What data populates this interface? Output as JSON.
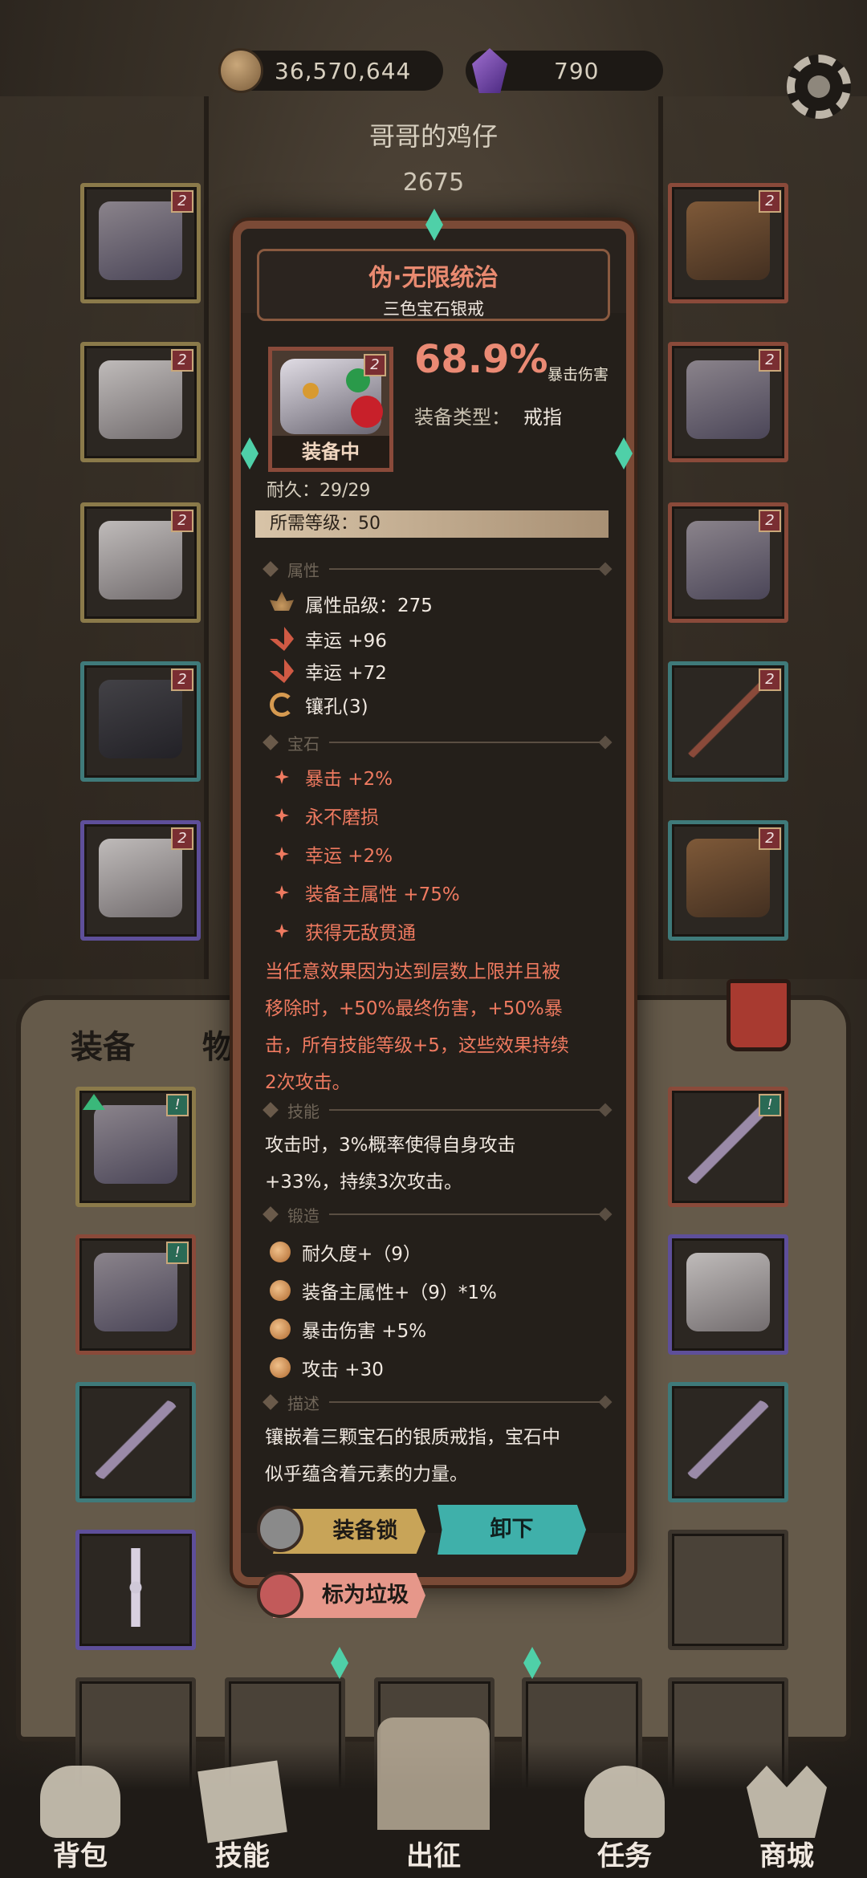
{
  "currency": {
    "gold": "36,570,644",
    "gems": "790"
  },
  "player": {
    "name": "哥哥的鸡仔",
    "power": "2675"
  },
  "tabs": {
    "equip": "装备",
    "items": "物品"
  },
  "item": {
    "name": "伪·无限统治",
    "subtitle": "三色宝石银戒",
    "level_badge": "2",
    "equipped_label": "装备中",
    "main_value": "68.9%",
    "main_stat": "暴击伤害",
    "type_label": "装备类型：",
    "type_value": "戒指",
    "durability": "耐久：29/29",
    "required_level": "所需等级：50",
    "sections": {
      "attributes": "属性",
      "gems": "宝石",
      "skills": "技能",
      "forge": "锻造",
      "description": "描述"
    },
    "attributes": [
      "属性品级：275",
      "幸运 +96",
      "幸运 +72",
      "镶孔(3)"
    ],
    "gem_effects": [
      "暴击 +2%",
      "永不磨损",
      "幸运 +2%",
      "装备主属性 +75%",
      "获得无敌贯通"
    ],
    "gem_description": [
      "当任意效果因为达到层数上限并且被",
      "移除时，+50%最终伤害，+50%暴",
      "击，所有技能等级+5，这些效果持续",
      "2次攻击。"
    ],
    "skill_text": [
      "攻击时，3%概率使得自身攻击",
      "+33%，持续3次攻击。"
    ],
    "forge": [
      "耐久度+（9）",
      "装备主属性+（9）*1%",
      "暴击伤害 +5%",
      "攻击 +30"
    ],
    "description": [
      "镶嵌着三颗宝石的银质戒指，宝石中",
      "似乎蕴含着元素的力量。"
    ]
  },
  "buttons": {
    "lock": "装备锁",
    "unequip": "卸下",
    "junk": "标为垃圾"
  },
  "slot_badges": {
    "level": "2",
    "bag": "!"
  },
  "nav": [
    "背包",
    "技能",
    "出征",
    "任务",
    "商城"
  ],
  "colors": {
    "accent_red": "#ef7a60",
    "teal_button": "#3fb0aa",
    "gold_button": "#c8a458"
  }
}
